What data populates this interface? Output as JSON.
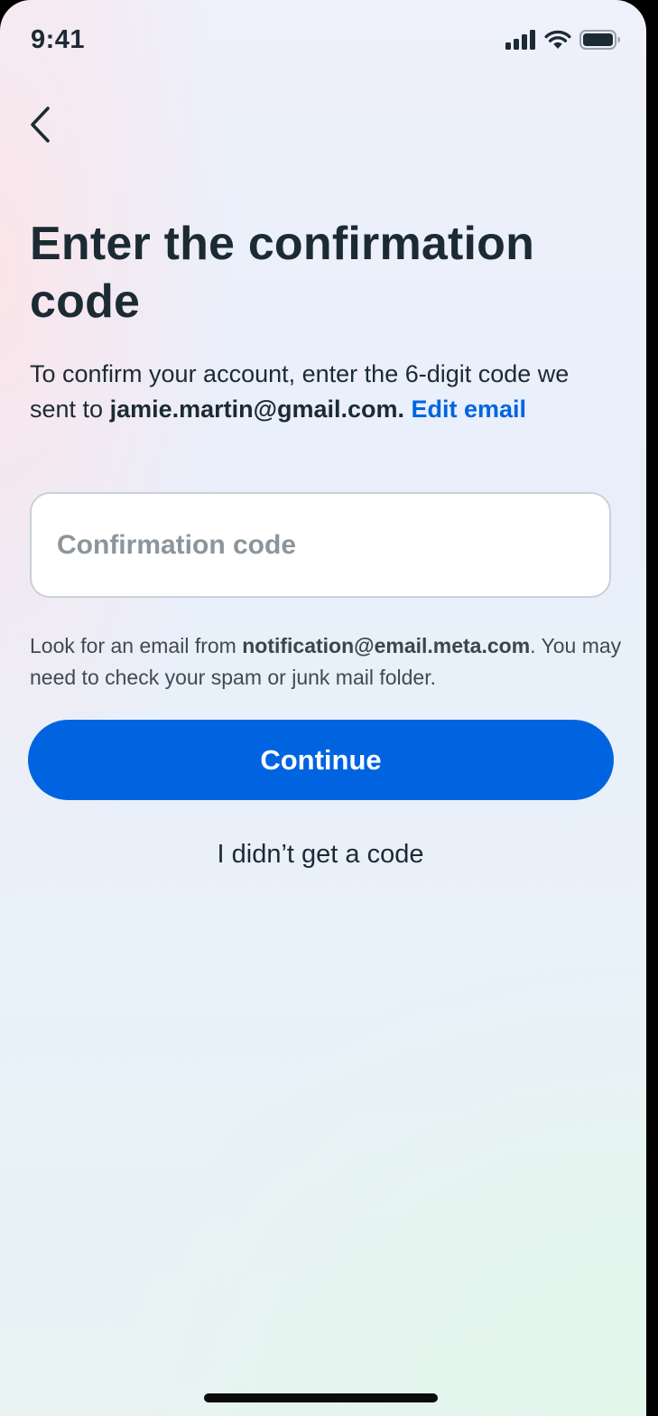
{
  "status_bar": {
    "time": "9:41",
    "icons": [
      "cellular-signal-icon",
      "wifi-icon",
      "battery-icon"
    ]
  },
  "nav": {
    "back_icon": "chevron-left-icon"
  },
  "title": "Enter the confirmation code",
  "description": {
    "prefix": "To confirm your account, enter the 6-digit code we sent to ",
    "email": "jamie.martin@gmail.com.",
    "edit_link": "Edit email"
  },
  "code_field": {
    "value": "",
    "placeholder": "Confirmation code"
  },
  "hint": {
    "prefix": "Look for an email from ",
    "sender": "notification@email.meta.com",
    "suffix": ". You may need to check your spam or junk mail folder."
  },
  "buttons": {
    "continue": "Continue",
    "no_code": "I didn’t get a code"
  },
  "colors": {
    "primary": "#0064e0",
    "text": "#1c2b33",
    "placeholder": "#8c959b"
  }
}
